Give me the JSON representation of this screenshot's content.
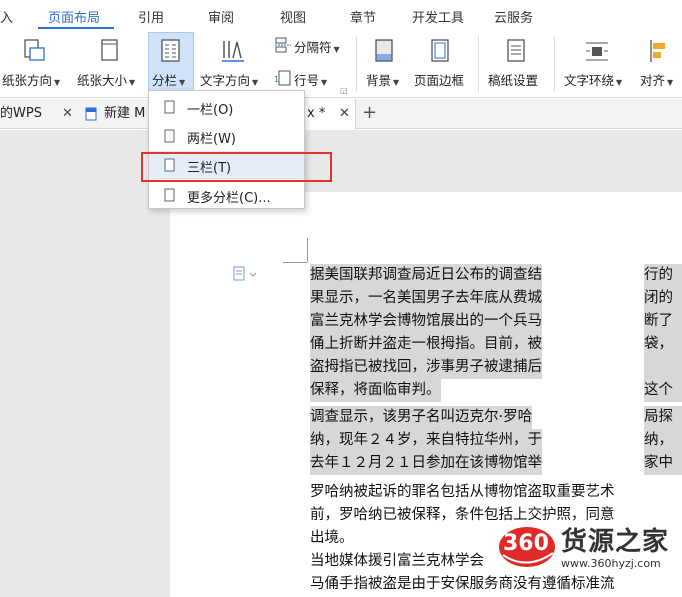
{
  "tabs": [
    {
      "label": "插入",
      "shown": "入"
    },
    {
      "label": "页面布局"
    },
    {
      "label": "引用"
    },
    {
      "label": "审阅"
    },
    {
      "label": "视图"
    },
    {
      "label": "章节"
    },
    {
      "label": "开发工具"
    },
    {
      "label": "云服务"
    }
  ],
  "ribbon": {
    "orientation": "纸张方向",
    "size": "纸张大小",
    "columns": "分栏",
    "text_direction": "文字方向",
    "separator": "分隔符",
    "line_number": "行号",
    "background": "背景",
    "page_border": "页面边框",
    "grid_paper": "稿纸设置",
    "text_wrap": "文字环绕",
    "align": "对齐"
  },
  "doc_tabs": {
    "tab1": "的WPS",
    "tab2": "新建 M",
    "tab3_suffix": "x *",
    "add": "+"
  },
  "columns_menu": {
    "items": [
      "一栏(O)",
      "两栏(W)",
      "三栏(T)",
      "更多分栏(C)..."
    ]
  },
  "document": {
    "column_lines": [
      "据美国联邦调查局近日公布的调查结",
      "果显示，一名美国男子去年底从费城",
      "富兰克林学会博物馆展出的一个兵马",
      "俑上折断并盗走一根拇指。目前，被",
      "盗拇指已被找回，涉事男子被逮捕后",
      "保释，将面临审判。",
      "调查显示，该男子名叫迈克尔·罗哈",
      "纳，现年２４岁，来自特拉华州，于",
      "去年１２月２１日参加在该博物馆举"
    ],
    "right_column_lines": [
      "行的",
      "闭的",
      "断了",
      "袋，",
      "",
      "这个",
      "局探",
      "纳，",
      "家中"
    ],
    "full_lines": [
      "罗哈纳被起诉的罪名包括从博物馆盗取重要艺术",
      "前，罗哈纳已被保释，条件包括上交护照，同意",
      "出境。",
      "当地媒体援引富兰克林学会",
      "马俑手指被盗是由于安保服务商没有遵循标准流"
    ]
  },
  "watermark": {
    "logo": "360",
    "name": "货源之家",
    "url": "www.360hyzj.com"
  }
}
